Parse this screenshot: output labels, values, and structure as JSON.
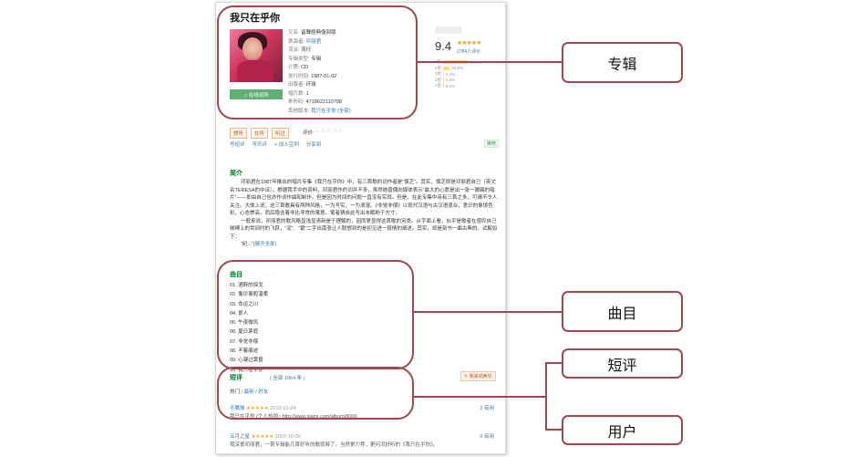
{
  "album": {
    "title": "我只在乎你",
    "listen_label": "♫ 在线试听",
    "info": [
      {
        "label": "又名:",
        "value": "留聲經典復刻版",
        "link": false
      },
      {
        "label": "表演者:",
        "value": "邓丽君",
        "link": true
      },
      {
        "label": "流派:",
        "value": "流行",
        "link": false
      },
      {
        "label": "专辑类型:",
        "value": "专辑",
        "link": false
      },
      {
        "label": "介质:",
        "value": "CD",
        "link": false
      },
      {
        "label": "发行时间:",
        "value": "1987-01-02",
        "link": false
      },
      {
        "label": "出版者:",
        "value": "环球",
        "link": false
      },
      {
        "label": "唱片数:",
        "value": "1",
        "link": false
      },
      {
        "label": "条形码:",
        "value": "4718622110798",
        "link": false
      },
      {
        "label": "其他版本:",
        "value": "我只在乎你 (全部)",
        "link": true
      }
    ]
  },
  "rating": {
    "score": "9.4",
    "stars": "★★★★★",
    "votes": "2784人评价",
    "distribution": [
      {
        "label": "5星",
        "pct": 77.1,
        "text": "77.1%"
      },
      {
        "label": "4星",
        "pct": 20.5,
        "text": "20.5%"
      },
      {
        "label": "3星",
        "pct": 2.4,
        "text": "2.4%"
      },
      {
        "label": "2星",
        "pct": 0.0,
        "text": "0.0%"
      },
      {
        "label": "1星",
        "pct": 0.1,
        "text": "0.1%"
      }
    ]
  },
  "status_tags": [
    "想听",
    "在听",
    "听过"
  ],
  "rate_label": "评价:",
  "rate_stars": "☆☆☆☆☆",
  "actions": [
    "写短评",
    "写乐评",
    "+ 加入豆列",
    "分享到"
  ],
  "recommend_label": "推荐",
  "intro": {
    "heading": "简介",
    "dots": "· · · · · ·",
    "paragraphs": [
      "邓丽君在1987年推出的唱片专集《我只在乎你》中，有三首歌的词作者是“慎芝”。其实，慎芝即是邓丽君自己（英文名TERESA的中译）。根据我手中的资料，邓丽君作的词并不多，虽然她曾偶向媒体表示“最大的心愿是出一张一脚踢的唱片”——即由自己包办作词作曲和制作。但是因为时间的问题一直没有实现。但是，在此专集中亲有三首之多，可谓不令人关注。大体上说，这三首歌具有两种风格，一为写实，一为浪漫。《非觉非偎》以现代汉语与古汉语混合，意识的象境色彩，心态崇高，而后隐含着非比寻常的寓意。笔者猜自此写出未眠粉于方寸。",
      "一般来说，邓丽君的歌风略显浅显清新是于理解的，因而更显得这首歌的另类。从字面上看，似乎是歌者在感叹自己绑缚上的世间时的飞跃，“泥”、“银”二字出南涨让人联想到的是初见进一段情的阐述。其实，却是刻书一曲古典的。试解如下：",
      "“纪...”"
    ],
    "more": "(展开全部)"
  },
  "tracks": {
    "heading": "曲目",
    "dots": "· · · · · ·",
    "items": [
      "01. 酒醉的探戈",
      "02. 像珍事般温柔",
      "03. 命运之川",
      "04. 爱人",
      "05. 午夜微风",
      "06. 夏日茅庭",
      "07. 非觉非偎",
      "08. 不着痕迹",
      "09. 心凝过黄昏",
      "10. 我只在乎你"
    ]
  },
  "reviews": {
    "heading": "短评",
    "dots": "· · · · · ·",
    "count": "( 全部 1964 条 )",
    "write_label": "✎ 我来说两句",
    "tabs": [
      "热门",
      "最新",
      "好友"
    ],
    "items": [
      {
        "user": "不撒独",
        "stars": "★★★★★",
        "date": "2010-10-24",
        "useful": "2 有用",
        "text": "我只在乎你 (个人热闹~ http://www.xiami.com/album/8000"
      },
      {
        "user": "五月之星",
        "stars": "★★★★★",
        "date": "2007-10-30",
        "useful": "0 有用",
        "text": "我深爱邓丽君，一首专辑能几首好听的歌就够了。当然更力荐，更何况好听的《我只在乎你》。"
      }
    ]
  },
  "annotations": {
    "album": "专辑",
    "tracks": "曲目",
    "short_reviews": "短评",
    "users": "用户",
    "accent_color": "#a0484f"
  }
}
